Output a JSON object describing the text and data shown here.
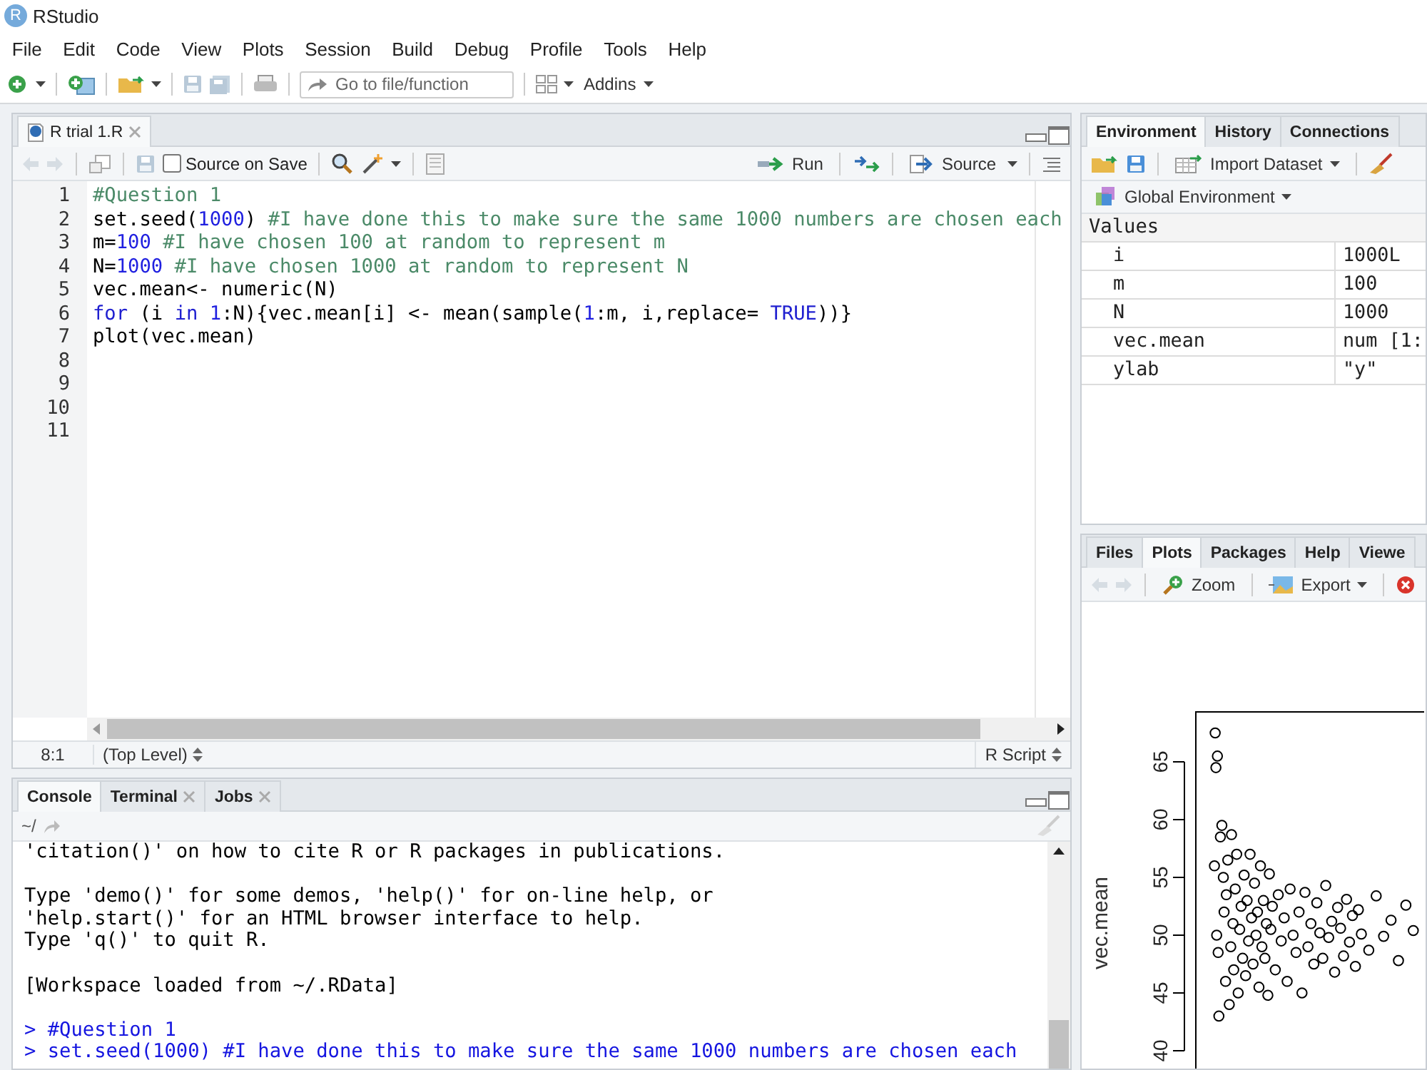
{
  "app": {
    "logo": "R",
    "title": "RStudio"
  },
  "menu": [
    "File",
    "Edit",
    "Code",
    "View",
    "Plots",
    "Session",
    "Build",
    "Debug",
    "Profile",
    "Tools",
    "Help"
  ],
  "toolbar": {
    "goto_placeholder": "Go to file/function",
    "addins": "Addins"
  },
  "editor": {
    "tabs": [
      {
        "label": "R trial 1.R",
        "selected": true,
        "closable": true
      }
    ],
    "source_on_save": {
      "label": "Source on Save",
      "checked": false
    },
    "run": "Run",
    "source": "Source",
    "lines": [
      {
        "number": "1",
        "tokens": [
          {
            "text": "#Question 1",
            "kind": "comment"
          }
        ]
      },
      {
        "number": "2",
        "tokens": [
          {
            "text": "set.seed(",
            "kind": "plain"
          },
          {
            "text": "1000",
            "kind": "number"
          },
          {
            "text": ") ",
            "kind": "plain"
          },
          {
            "text": "#I have done this to make sure the same 1000 numbers are chosen each",
            "kind": "comment"
          }
        ]
      },
      {
        "number": "3",
        "tokens": [
          {
            "text": "m=",
            "kind": "plain"
          },
          {
            "text": "100",
            "kind": "number"
          },
          {
            "text": " #I have chosen 100 at random to represent m",
            "kind": "comment"
          }
        ]
      },
      {
        "number": "4",
        "tokens": [
          {
            "text": "N=",
            "kind": "plain"
          },
          {
            "text": "1000",
            "kind": "number"
          },
          {
            "text": " #I have chosen 1000 at random to represent N",
            "kind": "comment"
          }
        ]
      },
      {
        "number": "5",
        "tokens": [
          {
            "text": "vec.mean<- numeric(N)",
            "kind": "plain"
          }
        ]
      },
      {
        "number": "6",
        "tokens": [
          {
            "text": "for",
            "kind": "keyword"
          },
          {
            "text": " (i ",
            "kind": "plain"
          },
          {
            "text": "in",
            "kind": "keyword"
          },
          {
            "text": " 1",
            "kind": "number"
          },
          {
            "text": ":N){vec.mean[i] <- mean(sample(",
            "kind": "plain"
          },
          {
            "text": "1",
            "kind": "number"
          },
          {
            "text": ":m, i,replace= ",
            "kind": "plain"
          },
          {
            "text": "TRUE",
            "kind": "keyword"
          },
          {
            "text": "))}",
            "kind": "plain"
          }
        ]
      },
      {
        "number": "7",
        "tokens": [
          {
            "text": "plot(vec.mean)",
            "kind": "plain"
          }
        ]
      },
      {
        "number": "8"
      },
      {
        "number": "9"
      },
      {
        "number": "10"
      },
      {
        "number": "11"
      }
    ],
    "status": {
      "position": "8:1",
      "scope": "(Top Level)",
      "file_type": "R Script"
    }
  },
  "console": {
    "tabs": [
      {
        "label": "Console",
        "selected": true,
        "closable": false
      },
      {
        "label": "Terminal",
        "selected": false,
        "closable": true
      },
      {
        "label": "Jobs",
        "selected": false,
        "closable": true
      }
    ],
    "path": "~/",
    "lines": [
      {
        "kind": "output",
        "text": "'citation()' on how to cite R or R packages in publications."
      },
      {
        "kind": "blank"
      },
      {
        "kind": "output",
        "text": "Type 'demo()' for some demos, 'help()' for on-line help, or"
      },
      {
        "kind": "output",
        "text": "'help.start()' for an HTML browser interface to help."
      },
      {
        "kind": "output",
        "text": "Type 'q()' to quit R."
      },
      {
        "kind": "blank"
      },
      {
        "kind": "output",
        "text": "[Workspace loaded from ~/.RData]"
      },
      {
        "kind": "blank"
      },
      {
        "kind": "input",
        "text": "> #Question 1"
      },
      {
        "kind": "input",
        "text": "> set.seed(1000) #I have done this to make sure the same 1000 numbers are chosen each"
      }
    ]
  },
  "environment": {
    "tabs": [
      {
        "label": "Environment",
        "selected": true
      },
      {
        "label": "History",
        "selected": false
      },
      {
        "label": "Connections",
        "selected": false
      }
    ],
    "import_dataset": "Import Dataset",
    "scope": "Global Environment",
    "section": "Values",
    "rows": [
      {
        "name": "i",
        "value": "1000L"
      },
      {
        "name": "m",
        "value": "100"
      },
      {
        "name": "N",
        "value": "1000"
      },
      {
        "name": "vec.mean",
        "value": "num [1:"
      },
      {
        "name": "ylab",
        "value": "\"y\""
      }
    ]
  },
  "plots_pane": {
    "tabs": [
      {
        "label": "Files",
        "selected": false
      },
      {
        "label": "Plots",
        "selected": true
      },
      {
        "label": "Packages",
        "selected": false
      },
      {
        "label": "Help",
        "selected": false
      },
      {
        "label": "Viewe",
        "selected": false
      }
    ],
    "zoom": "Zoom",
    "export": "Export",
    "plot": {
      "ylabel": "vec.mean",
      "yticks": [
        "65",
        "60",
        "55",
        "50",
        "45",
        "40"
      ]
    }
  }
}
